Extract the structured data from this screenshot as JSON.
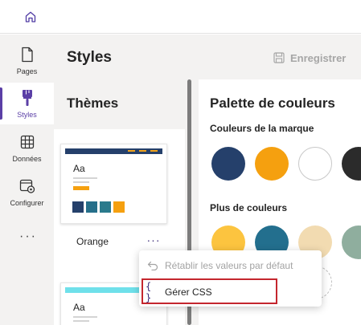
{
  "topbar": {
    "home_icon": "home-icon"
  },
  "nav": {
    "items": [
      {
        "label": "Pages",
        "icon": "page-icon"
      },
      {
        "label": "Styles",
        "icon": "paintbrush-icon",
        "active": true
      },
      {
        "label": "Données",
        "icon": "table-icon"
      },
      {
        "label": "Configurer",
        "icon": "settings-window-icon"
      }
    ],
    "more": "···"
  },
  "header": {
    "title": "Styles",
    "save_label": "Enregistrer"
  },
  "themes": {
    "title": "Thèmes",
    "cards": [
      {
        "name": "Orange",
        "aa": "Aa",
        "strip_color": "#25406b",
        "accent_color": "#f5a00f",
        "swatches": [
          "#25406b",
          "#266f8a",
          "#2a7a8c",
          "#f5a00f"
        ]
      },
      {
        "name": "",
        "aa": "Aa",
        "strip_color": "#6fe0ea",
        "accent_color": "#d4d4d4",
        "swatches": []
      }
    ],
    "more_label": "···"
  },
  "palette": {
    "title": "Palette de couleurs",
    "brand_label": "Couleurs de la marque",
    "brand_colors": [
      "#25406b",
      "#f5a00f",
      "#ffffff",
      "#2b2b2b"
    ],
    "more_label": "Plus de couleurs",
    "more_colors": [
      "#fcc43f",
      "#236f8e",
      "#f2dbb1",
      "#8fae9e"
    ]
  },
  "context_menu": {
    "items": [
      {
        "label": "Rétablir les valeurs par défaut",
        "icon": "undo-icon",
        "disabled": true
      },
      {
        "label": "Gérer CSS",
        "icon": "braces-icon",
        "icon_text": "{ }",
        "highlighted": true
      }
    ]
  },
  "colors": {
    "accent": "#5b3fa6",
    "highlight": "#c4262e"
  }
}
